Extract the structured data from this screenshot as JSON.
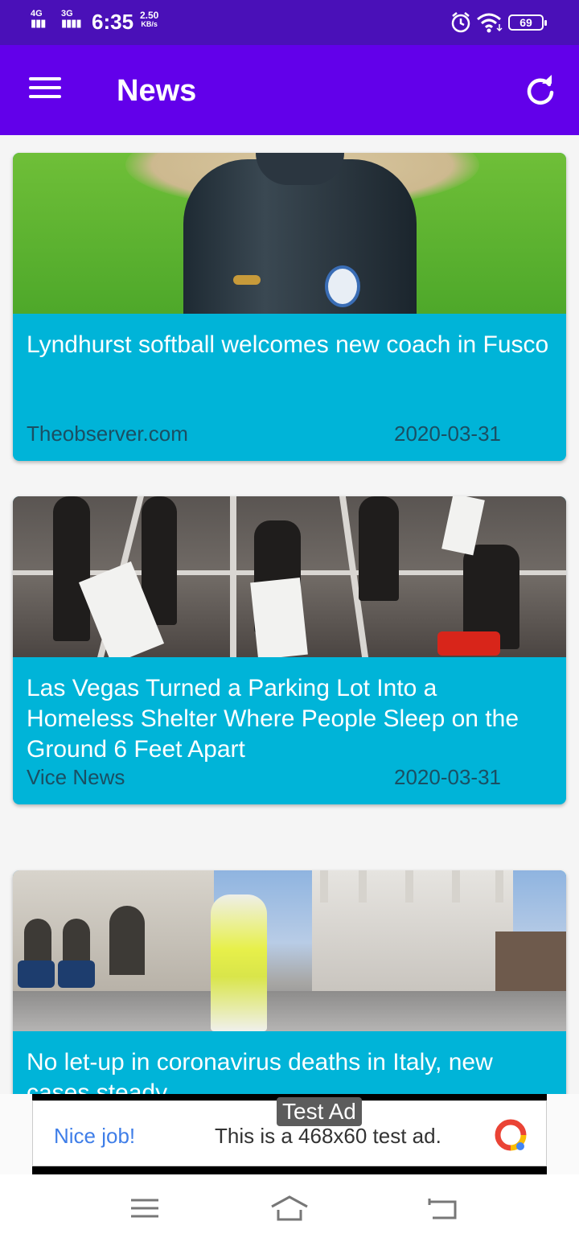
{
  "status_bar": {
    "network1": "4G",
    "network2": "3G",
    "time": "6:35",
    "speed_value": "2.50",
    "speed_unit": "KB/s",
    "battery": "69",
    "icons": [
      "signal-icon",
      "alarm-icon",
      "wifi-icon",
      "battery-icon"
    ]
  },
  "app_bar": {
    "title": "News",
    "menu_icon": "hamburger-menu-icon",
    "refresh_icon": "refresh-icon",
    "color": "#6200ea"
  },
  "articles": [
    {
      "title": "Lyndhurst softball welcomes new coach in Fusco",
      "source": "Theobserver.com",
      "date": "2020-03-31"
    },
    {
      "title": "Las Vegas Turned a Parking Lot Into a Homeless Shelter Where People Sleep on the Ground 6 Feet Apart",
      "source": "Vice News",
      "date": "2020-03-31"
    },
    {
      "title": "No let-up in coronavirus deaths in Italy, new cases steady",
      "source": "",
      "date": ""
    }
  ],
  "card_color": "#00b4d8",
  "ad": {
    "label": "Test Ad",
    "headline": "Nice job!",
    "text": "This is a 468x60 test ad."
  },
  "nav_bar": {
    "icons": [
      "recent-apps-icon",
      "home-icon",
      "back-icon"
    ]
  }
}
